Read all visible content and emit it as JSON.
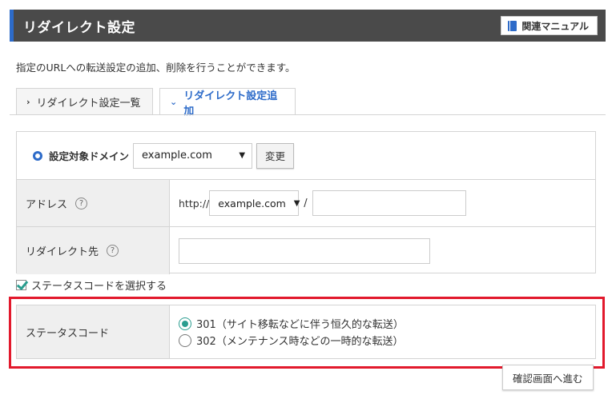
{
  "header": {
    "title": "リダイレクト設定",
    "manual_label": "関連マニュアル"
  },
  "description": "指定のURLへの転送設定の追加、削除を行うことができます。",
  "tabs": [
    {
      "label": "リダイレクト設定一覧",
      "chevron": "›",
      "active": false
    },
    {
      "label": "リダイレクト設定追加",
      "chevron": "⌄",
      "active": true
    }
  ],
  "domain": {
    "label": "設定対象ドメイン",
    "selected": "example.com",
    "change_label": "変更"
  },
  "address": {
    "label": "アドレス",
    "help": "?",
    "prefix": "http://",
    "domain_selected": "example.com",
    "separator": "/",
    "path_value": ""
  },
  "redirect_target": {
    "label": "リダイレクト先",
    "help": "?",
    "value": ""
  },
  "status_checkbox": {
    "label": "ステータスコードを選択する",
    "checked": true
  },
  "status": {
    "label": "ステータスコード",
    "options": [
      {
        "label": "301（サイト移転などに伴う恒久的な転送）",
        "selected": true
      },
      {
        "label": "302（メンテナンス時などの一時的な転送）",
        "selected": false
      }
    ]
  },
  "confirm_label": "確認画面へ進む",
  "colors": {
    "accent": "#2d6bc9",
    "highlight": "#e2192c",
    "radio_selected": "#2a9d8f"
  }
}
